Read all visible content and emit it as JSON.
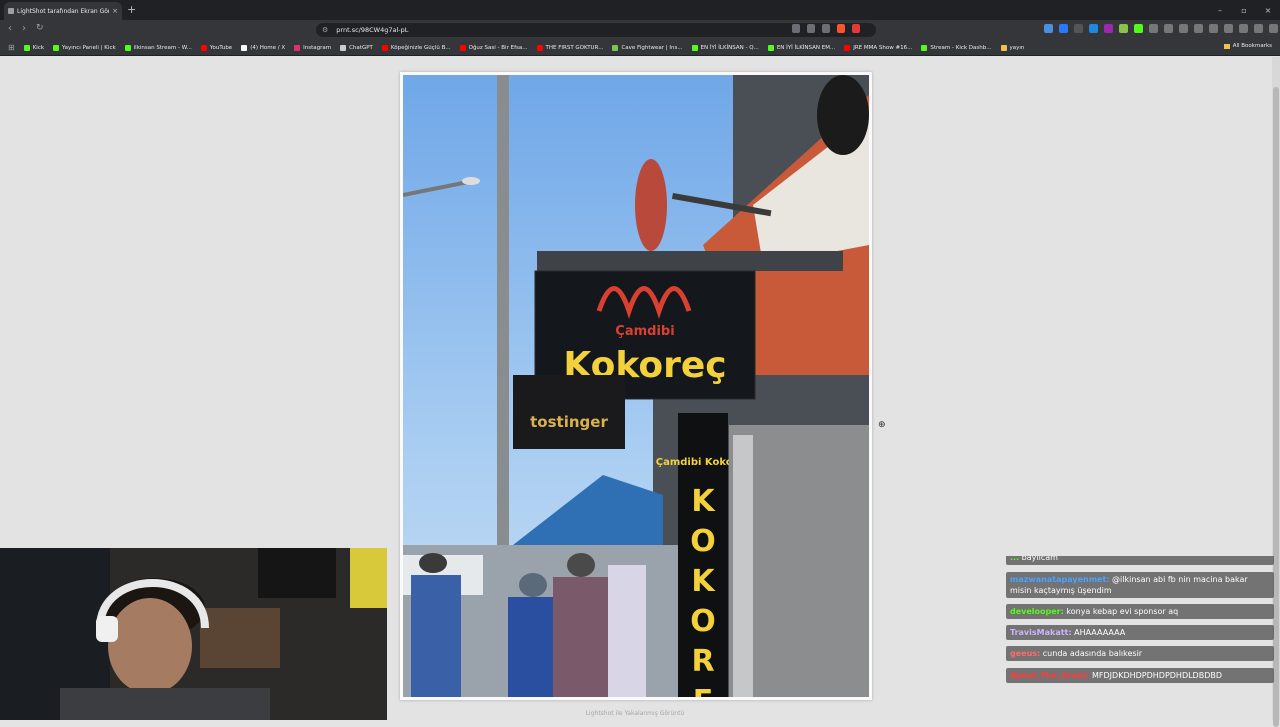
{
  "browser": {
    "tab_title": "LightShot tarafından Ekran Görü",
    "tab_close": "×",
    "new_tab": "+",
    "url": "prnt.sc/98CW4g7al-pL",
    "window_controls": [
      "–",
      "▫",
      "×"
    ],
    "bookmarks": [
      {
        "label": "Kick",
        "color": "#53fc18"
      },
      {
        "label": "Yayıncı Paneli | Kick",
        "color": "#53fc18"
      },
      {
        "label": "ilkinsan Stream - W...",
        "color": "#53fc18"
      },
      {
        "label": "YouTube",
        "color": "#ff0000"
      },
      {
        "label": "(4) Home / X",
        "color": "#ffffff"
      },
      {
        "label": "Instagram",
        "color": "#e1306c"
      },
      {
        "label": "ChatGPT",
        "color": "#cccccc"
      },
      {
        "label": "Köpeğinizle Güçlü B...",
        "color": "#ff0000"
      },
      {
        "label": "Oğuz Sasi - Bir Efsa...",
        "color": "#ff0000"
      },
      {
        "label": "THE FIRST GOKTUR...",
        "color": "#ff0000"
      },
      {
        "label": "Cave Fightwear | Ins...",
        "color": "#7ac74f"
      },
      {
        "label": "EN İYİ İLKİNSAN - Q...",
        "color": "#53fc18"
      },
      {
        "label": "EN İYİ İLKİNSAN EM...",
        "color": "#53fc18"
      },
      {
        "label": "JRE MMA Show #16...",
        "color": "#ff0000"
      },
      {
        "label": "Stream - Kick Dashb...",
        "color": "#53fc18"
      },
      {
        "label": "yayın",
        "color": "#f0c14b"
      }
    ],
    "all_bookmarks": "All Bookmarks"
  },
  "photo": {
    "sign_brand": "Çamdibi",
    "sign_main": "Kokoreç",
    "sign_small": "Çamdibi Kokoreç",
    "vertical_letters": [
      "K",
      "O",
      "K",
      "O",
      "R",
      "E"
    ],
    "side_sign": "tostinger"
  },
  "footer_caption": "Lightshot ile Yakalanmış Görüntü",
  "chat": {
    "messages": [
      {
        "user": "...",
        "user_color": "#53fc18",
        "text": "bayılcam"
      },
      {
        "user": "mazwanatapayenmet:",
        "user_color": "#4aa3ff",
        "text": "@ilkinsan abi fb nin macina bakar misin kaçtaymış üşendim"
      },
      {
        "user": "develooper:",
        "user_color": "#53fc18",
        "text": "konya kebap evi sponsor aq"
      },
      {
        "user": "TravisMakatt:",
        "user_color": "#c9b6ff",
        "text": "AHAAAAAAA"
      },
      {
        "user": "geeus:",
        "user_color": "#ff6b6b",
        "text": "cunda adasında balıkesir"
      },
      {
        "user": "Ajmet_The_Great:",
        "user_color": "#ff3b3b",
        "text": "MFDJDKDHDPDHDPDHDLDBDBD"
      }
    ]
  }
}
